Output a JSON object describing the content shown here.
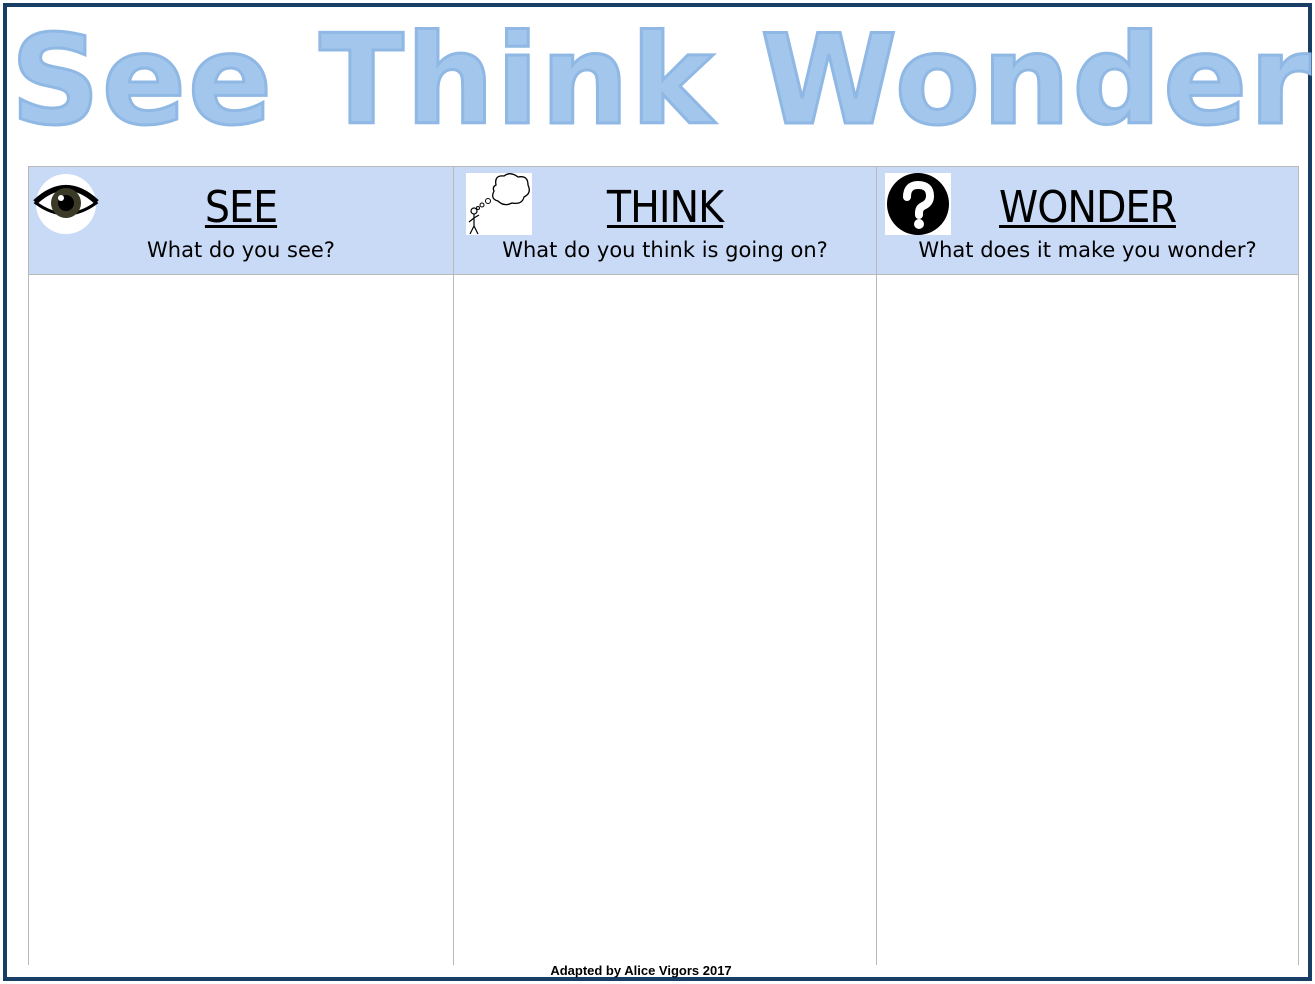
{
  "title": "See Think Wonder",
  "columns": [
    {
      "heading": "SEE",
      "prompt": "What do you see?",
      "icon": "eye-icon"
    },
    {
      "heading": "THINK",
      "prompt": "What do you think is going on?",
      "icon": "thought-bubble-icon"
    },
    {
      "heading": "WONDER",
      "prompt": "What does it make you wonder?",
      "icon": "question-mark-icon"
    }
  ],
  "footer": "Adapted by Alice Vigors 2017",
  "colors": {
    "border": "#183e66",
    "title": "#a3c6ec",
    "header_fill": "#c9daf7",
    "grid_line": "#b9b9b9"
  }
}
